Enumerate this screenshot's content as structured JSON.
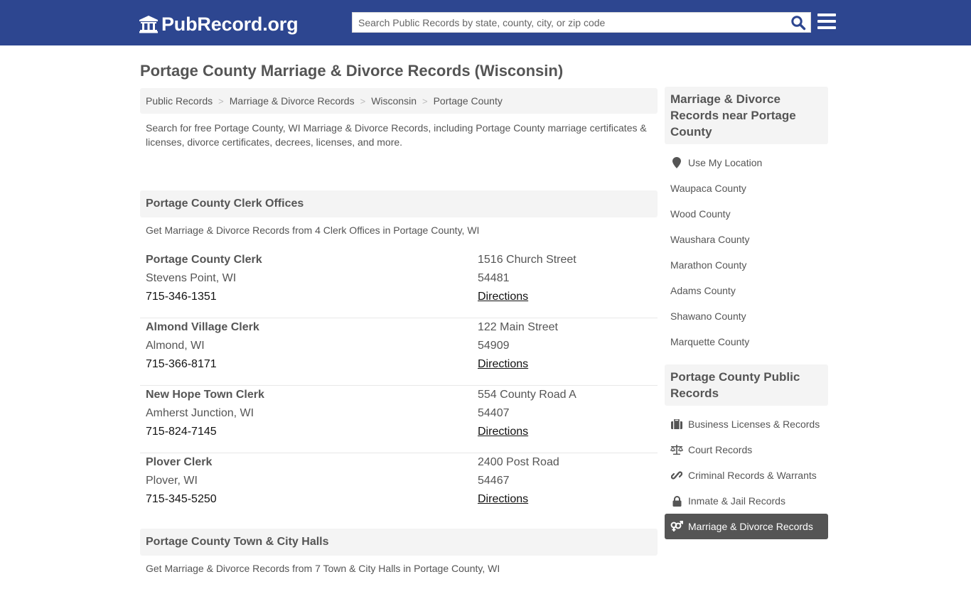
{
  "header": {
    "logo_text": "PubRecord.org",
    "logo_icon": "courthouse-icon",
    "search_placeholder": "Search Public Records by state, county, city, or zip code",
    "search_value": "",
    "search_icon": "search-icon",
    "menu_icon": "hamburger-menu-icon",
    "brand_color": "#2d4690"
  },
  "page": {
    "title": "Portage County Marriage & Divorce Records (Wisconsin)",
    "breadcrumb": [
      "Public Records",
      "Marriage & Divorce Records",
      "Wisconsin",
      "Portage County"
    ],
    "breadcrumb_separator": ">",
    "intro": "Search for free Portage County, WI Marriage & Divorce Records, including Portage County marriage certificates & licenses, divorce certificates, decrees, licenses, and more."
  },
  "clerk_section": {
    "heading": "Portage County Clerk Offices",
    "subtext": "Get Marriage & Divorce Records from 4 Clerk Offices in Portage County, WI",
    "offices": [
      {
        "name": "Portage County Clerk",
        "city": "Stevens Point, WI",
        "phone": "715-346-1351",
        "address": "1516 Church Street",
        "zip": "54481",
        "directions": "Directions"
      },
      {
        "name": "Almond Village Clerk",
        "city": "Almond, WI",
        "phone": "715-366-8171",
        "address": "122 Main Street",
        "zip": "54909",
        "directions": "Directions"
      },
      {
        "name": "New Hope Town Clerk",
        "city": "Amherst Junction, WI",
        "phone": "715-824-7145",
        "address": "554 County Road A",
        "zip": "54407",
        "directions": "Directions"
      },
      {
        "name": "Plover Clerk",
        "city": "Plover, WI",
        "phone": "715-345-5250",
        "address": "2400 Post Road",
        "zip": "54467",
        "directions": "Directions"
      }
    ]
  },
  "halls_section": {
    "heading": "Portage County Town & City Halls",
    "subtext": "Get Marriage & Divorce Records from 7 Town & City Halls in Portage County, WI"
  },
  "sidebar": {
    "nearby_heading": "Marriage & Divorce Records near Portage County",
    "use_location": "Use My Location",
    "nearby": [
      "Waupaca County",
      "Wood County",
      "Waushara County",
      "Marathon County",
      "Adams County",
      "Shawano County",
      "Marquette County"
    ],
    "public_heading": "Portage County Public Records",
    "public_records": [
      {
        "label": "Business Licenses & Records",
        "icon": "briefcase-icon",
        "active": false
      },
      {
        "label": "Court Records",
        "icon": "balance-scale-icon",
        "active": false
      },
      {
        "label": "Criminal Records & Warrants",
        "icon": "link-icon",
        "active": false
      },
      {
        "label": "Inmate & Jail Records",
        "icon": "lock-icon",
        "active": false
      },
      {
        "label": "Marriage & Divorce Records",
        "icon": "venus-mars-icon",
        "active": true
      }
    ],
    "active_color": "#555555"
  }
}
